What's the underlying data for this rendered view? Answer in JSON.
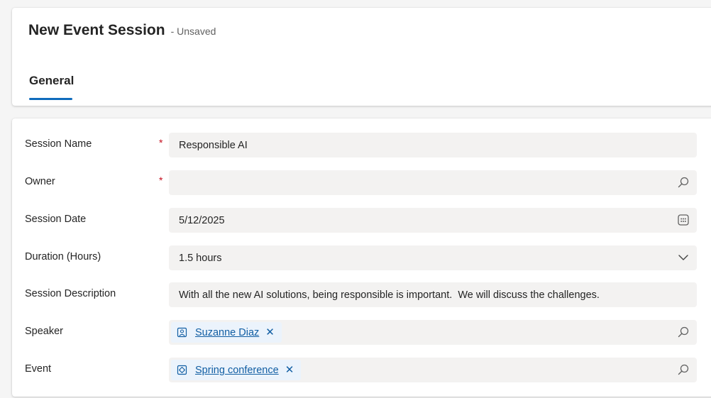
{
  "header": {
    "title": "New Event Session",
    "status": "- Unsaved",
    "tabs": [
      {
        "label": "General",
        "selected": true
      }
    ]
  },
  "form": {
    "fields": [
      {
        "label": "Session Name",
        "required": true,
        "value": "Responsible AI"
      },
      {
        "label": "Owner",
        "required": true,
        "value": "",
        "icon": "search-icon"
      },
      {
        "label": "Session Date",
        "required": false,
        "value": "5/12/2025",
        "icon": "calendar-icon"
      },
      {
        "label": "Duration (Hours)",
        "required": false,
        "value": "1.5 hours",
        "icon": "chevron-down-icon"
      },
      {
        "label": "Session Description",
        "required": false,
        "value": "With all the new AI solutions, being responsible is important.  We will discuss the challenges."
      },
      {
        "label": "Speaker",
        "required": false,
        "tag": "Suzanne Diaz",
        "tag_icon": "contact-icon",
        "icon": "search-icon"
      },
      {
        "label": "Event",
        "required": false,
        "tag": "Spring conference",
        "tag_icon": "event-icon",
        "icon": "search-icon"
      }
    ],
    "required_marker": "*"
  },
  "colors": {
    "accent": "#0f6cbd",
    "required": "#c50f1f",
    "field_bg": "#f3f2f1",
    "tag_bg": "#ebf3fc",
    "link": "#115ea3"
  }
}
